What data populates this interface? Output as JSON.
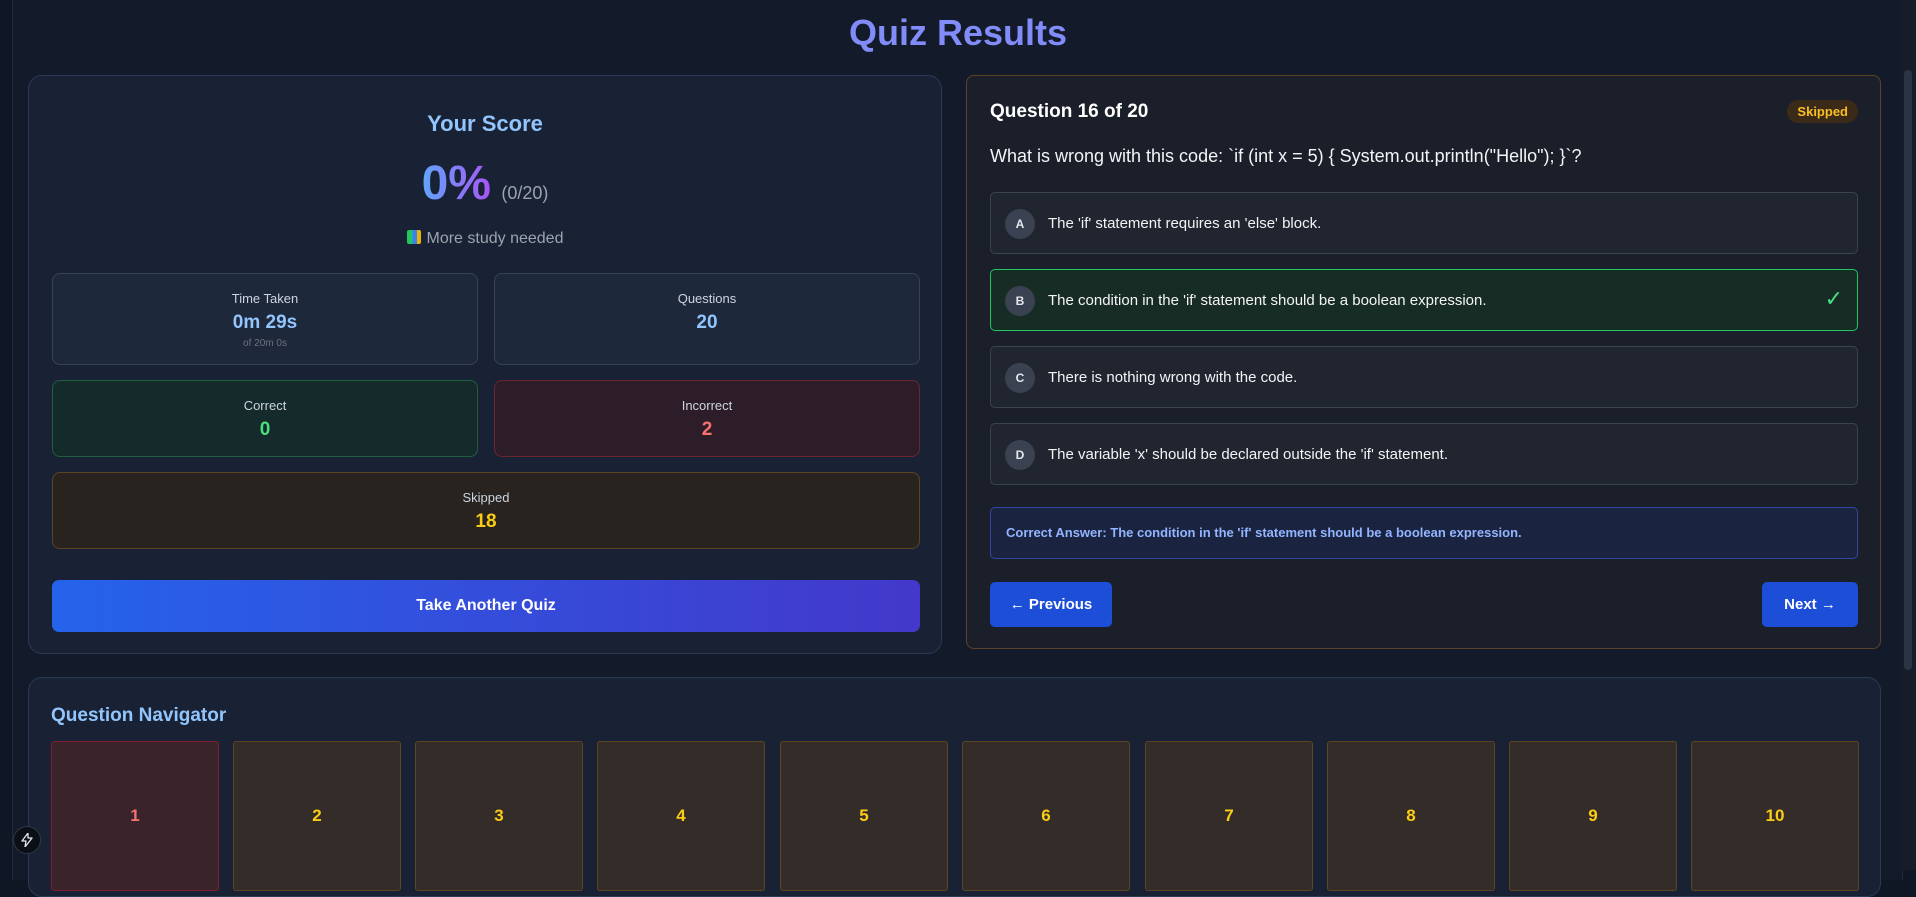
{
  "page": {
    "title": "Quiz Results"
  },
  "score": {
    "heading": "Your Score",
    "percent": "0%",
    "fraction": "(0/20)",
    "message": "More study needed",
    "message_icon": "books-icon",
    "stats": {
      "time": {
        "label": "Time Taken",
        "value": "0m 29s",
        "sub": "of 20m 0s"
      },
      "questions": {
        "label": "Questions",
        "value": "20"
      },
      "correct": {
        "label": "Correct",
        "value": "0"
      },
      "incorrect": {
        "label": "Incorrect",
        "value": "2"
      },
      "skipped": {
        "label": "Skipped",
        "value": "18"
      }
    },
    "retake_label": "Take Another Quiz"
  },
  "question": {
    "number_label": "Question 16 of 20",
    "status_badge": "Skipped",
    "text": "What is wrong with this code: `if (int x = 5) { System.out.println(\"Hello\"); }`?",
    "options": [
      {
        "letter": "A",
        "text": "The 'if' statement requires an 'else' block.",
        "correct": false
      },
      {
        "letter": "B",
        "text": "The condition in the 'if' statement should be a boolean expression.",
        "correct": true
      },
      {
        "letter": "C",
        "text": "There is nothing wrong with the code.",
        "correct": false
      },
      {
        "letter": "D",
        "text": "The variable 'x' should be declared outside the 'if' statement.",
        "correct": false
      }
    ],
    "check_mark": "✓",
    "correct_answer": "Correct Answer: The condition in the 'if' statement should be a boolean expression.",
    "prev_label": "← Previous",
    "next_label": "Next →"
  },
  "navigator": {
    "title": "Question Navigator",
    "tiles": [
      {
        "label": "1",
        "status": "incorrect"
      },
      {
        "label": "2",
        "status": "skipped"
      },
      {
        "label": "3",
        "status": "skipped"
      },
      {
        "label": "4",
        "status": "skipped"
      },
      {
        "label": "5",
        "status": "skipped"
      },
      {
        "label": "6",
        "status": "skipped"
      },
      {
        "label": "7",
        "status": "skipped"
      },
      {
        "label": "8",
        "status": "skipped"
      },
      {
        "label": "9",
        "status": "skipped"
      },
      {
        "label": "10",
        "status": "skipped"
      }
    ]
  },
  "colors": {
    "accent": "#818cf8",
    "correct": "#4ade80",
    "incorrect": "#f87171",
    "skipped": "#facc15",
    "button": "#1d4ed8"
  },
  "fab_icon": "bolt-icon"
}
